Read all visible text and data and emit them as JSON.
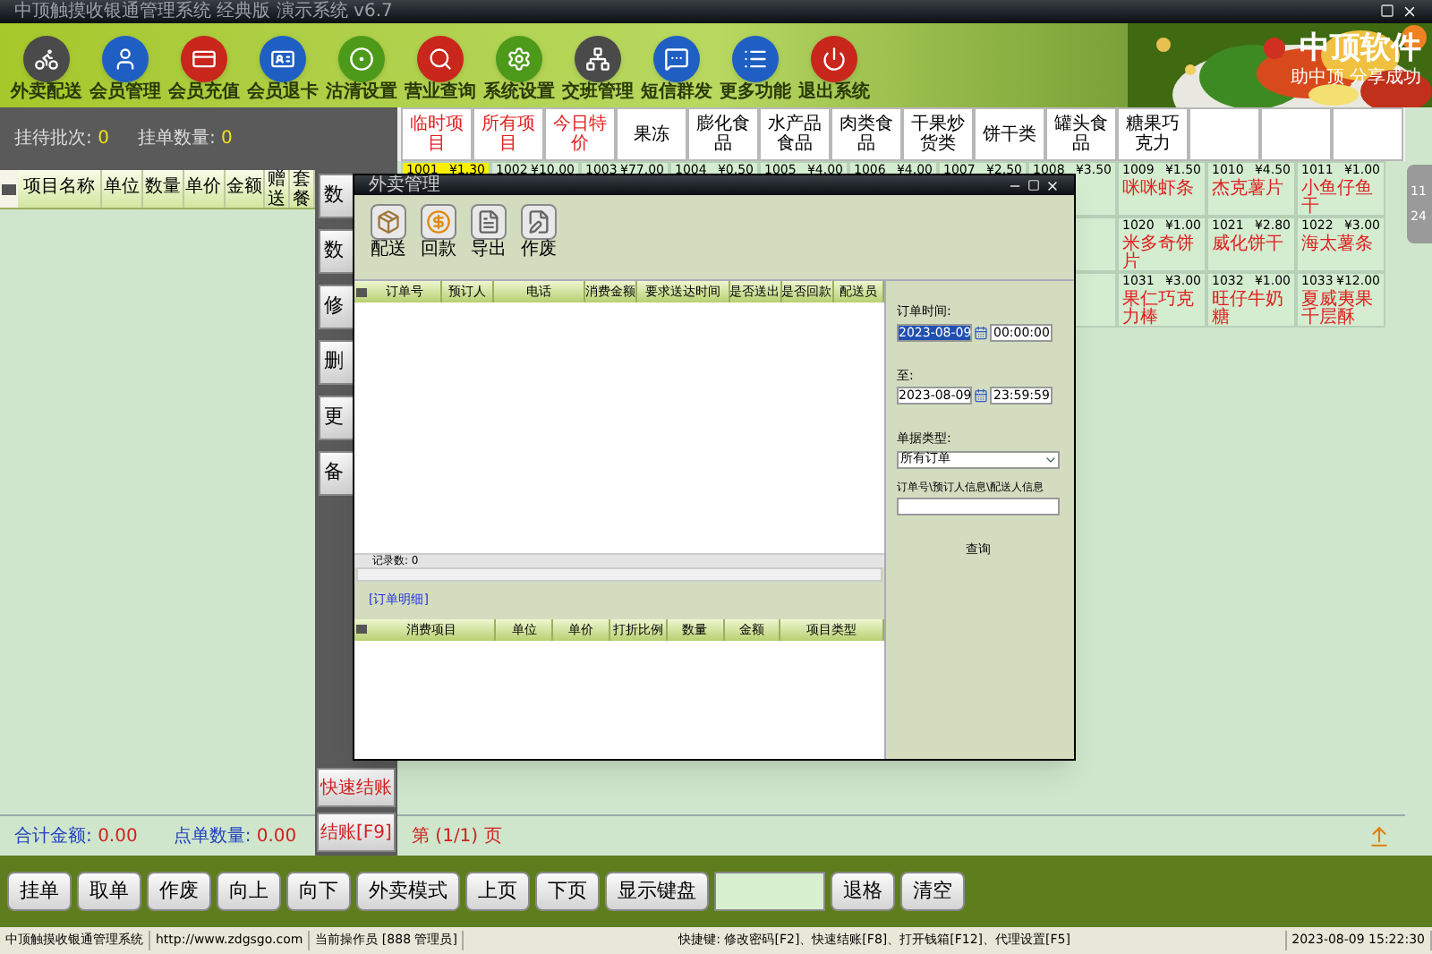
{
  "title_bar": {
    "title": "中顶触摸收银通管理系统 经典版 演示系统 v6.7"
  },
  "toolbar": [
    {
      "label": "外卖配送",
      "kind": "scooter",
      "color": "#4a4a4a"
    },
    {
      "label": "会员管理",
      "kind": "user",
      "color": "#1f5fc4"
    },
    {
      "label": "会员充值",
      "kind": "card",
      "color": "#c9261c"
    },
    {
      "label": "会员退卡",
      "kind": "idcard",
      "color": "#1f5fc4"
    },
    {
      "label": "沽清设置",
      "kind": "dish",
      "color": "#4d9a1a"
    },
    {
      "label": "营业查询",
      "kind": "search",
      "color": "#c9261c"
    },
    {
      "label": "系统设置",
      "kind": "gear",
      "color": "#4d9a1a"
    },
    {
      "label": "交班管理",
      "kind": "network",
      "color": "#4a4a4a"
    },
    {
      "label": "短信群发",
      "kind": "chat",
      "color": "#1f5fc4"
    },
    {
      "label": "更多功能",
      "kind": "list",
      "color": "#1f5fc4"
    },
    {
      "label": "退出系统",
      "kind": "power",
      "color": "#c9261c"
    }
  ],
  "logo": {
    "name": "中顶软件",
    "slogan": "助中顶 分享成功"
  },
  "order_panel": {
    "pending_label": "挂待批次:",
    "pending_value": "0",
    "held_label": "挂单数量:",
    "held_value": "0",
    "columns": [
      {
        "label": "项目名称",
        "kind": "wide"
      },
      {
        "label": "单位",
        "kind": "normal"
      },
      {
        "label": "数量",
        "kind": "normal"
      },
      {
        "label": "单价",
        "kind": "normal"
      },
      {
        "label": "金额",
        "kind": "normal"
      },
      {
        "label": "赠送",
        "kind": "vertical"
      },
      {
        "label": "套餐",
        "kind": "vertical"
      }
    ],
    "total_label": "合计金额:",
    "total_value": "0.00",
    "count_label": "点单数量:",
    "count_value": "0.00"
  },
  "side_buttons_top": [
    "数",
    "数",
    "修",
    "删",
    "更",
    "备"
  ],
  "side_buttons_bottom": [
    "快速结账",
    "结账[F9]"
  ],
  "categories": [
    {
      "label": "临时项目",
      "kind": "special"
    },
    {
      "label": "所有项目",
      "kind": "special"
    },
    {
      "label": "今日特价",
      "kind": "special"
    },
    {
      "label": "果冻",
      "kind": "normal"
    },
    {
      "label": "膨化食品",
      "kind": "normal"
    },
    {
      "label": "水产品食品",
      "kind": "normal"
    },
    {
      "label": "肉类食品",
      "kind": "normal"
    },
    {
      "label": "干果炒货类",
      "kind": "normal"
    },
    {
      "label": "饼干类",
      "kind": "normal"
    },
    {
      "label": "罐头食品",
      "kind": "normal"
    },
    {
      "label": "糖果巧克力",
      "kind": "normal"
    }
  ],
  "product_rows": [
    [
      {
        "code": "1001",
        "price": "¥1.30",
        "selected": true
      },
      {
        "code": "1002",
        "price": "¥10.00",
        "selected": false
      },
      {
        "code": "1003",
        "price": "¥77.00",
        "selected": false
      },
      {
        "code": "1004",
        "price": "¥0.50",
        "selected": false
      },
      {
        "code": "1005",
        "price": "¥4.00",
        "selected": false
      },
      {
        "code": "1006",
        "price": "¥4.00",
        "selected": false
      },
      {
        "code": "1007",
        "price": "¥2.50",
        "selected": false
      },
      {
        "code": "1008",
        "price": "¥3.50",
        "selected": false
      },
      {
        "code": "1009",
        "price": "¥1.50",
        "name": "咪咪虾条",
        "selected": false
      },
      {
        "code": "1010",
        "price": "¥4.50",
        "name": "杰克薯片",
        "selected": false
      },
      {
        "code": "1011",
        "price": "¥1.00",
        "name": "小鱼仔鱼干",
        "selected": false
      }
    ],
    [
      {
        "code": "1020",
        "price": "¥1.00",
        "name": "米多奇饼片",
        "selected": false
      },
      {
        "code": "1021",
        "price": "¥2.80",
        "name": "威化饼干",
        "selected": false
      },
      {
        "code": "1022",
        "price": "¥3.00",
        "name": "海太薯条",
        "selected": false
      }
    ],
    [
      {
        "code": "1031",
        "price": "¥3.00",
        "name": "果仁巧克力棒",
        "selected": false
      },
      {
        "code": "1032",
        "price": "¥1.00",
        "name": "旺仔牛奶糖",
        "selected": false
      },
      {
        "code": "1033",
        "price": "¥12.00",
        "name": "夏威夷果千层酥",
        "selected": false
      }
    ]
  ],
  "side_widget": [
    "11",
    "24"
  ],
  "dialog": {
    "title": "外卖管理",
    "tools": [
      {
        "label": "配送",
        "kind": "package"
      },
      {
        "label": "回款",
        "kind": "money"
      },
      {
        "label": "导出",
        "kind": "export"
      },
      {
        "label": "作废",
        "kind": "void"
      }
    ],
    "order_columns": [
      "订单号",
      "预订人",
      "电话",
      "消费金额",
      "要求送达时间",
      "是否送出",
      "是否回款",
      "配送员"
    ],
    "record_count": "记录数: 0",
    "detail_link": "[订单明细]",
    "detail_columns": [
      "消费项目",
      "单位",
      "单价",
      "打折比例",
      "数量",
      "金额",
      "项目类型"
    ],
    "filters": {
      "time_label": "订单时间:",
      "from_date": "2023-08-09",
      "from_date_highlighted": true,
      "from_time": "00:00:00",
      "to_label": "至:",
      "to_date": "2023-08-09",
      "to_time": "23:59:59",
      "type_label": "单据类型:",
      "type_value": "所有订单",
      "keyword_label": "订单号\\预订人信息\\配送人信息",
      "query_button": "查询"
    }
  },
  "page_indicator": "第 (1/1) 页",
  "bottom_buttons": [
    {
      "label": "挂单",
      "kind": "button"
    },
    {
      "label": "取单",
      "kind": "button"
    },
    {
      "label": "作废",
      "kind": "button"
    },
    {
      "label": "向上",
      "kind": "button"
    },
    {
      "label": "向下",
      "kind": "button"
    },
    {
      "label": "外卖模式",
      "kind": "button"
    },
    {
      "label": "上页",
      "kind": "button"
    },
    {
      "label": "下页",
      "kind": "button"
    },
    {
      "label": "显示键盘",
      "kind": "button"
    },
    {
      "kind": "input"
    },
    {
      "label": "退格",
      "kind": "button"
    },
    {
      "label": "清空",
      "kind": "button"
    }
  ],
  "status_bar": [
    "中顶触摸收银通管理系统",
    "http://www.zdgsgo.com",
    "当前操作员 [888 管理员]",
    "快捷键: 修改密码[F2]、快速结账[F8]、打开钱箱[F12]、代理设置[F5]",
    "2023-08-09 15:22:30"
  ]
}
